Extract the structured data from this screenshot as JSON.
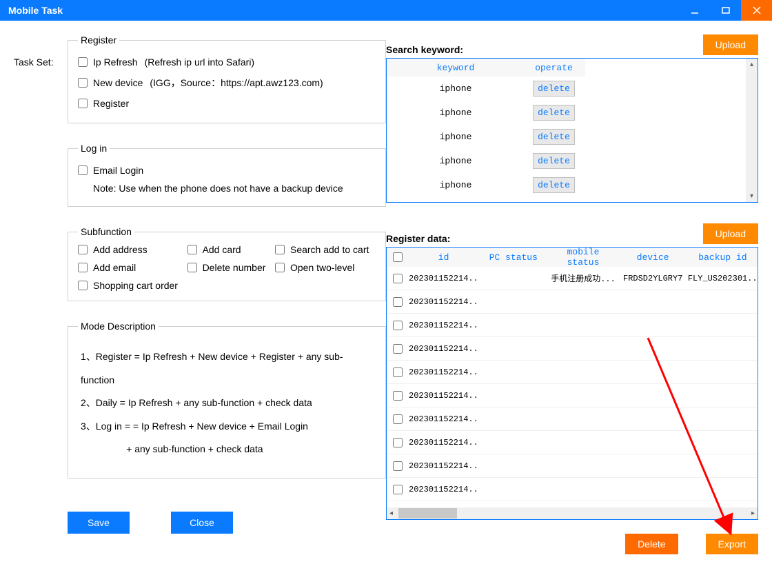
{
  "window": {
    "title": "Mobile Task"
  },
  "left": {
    "taskset_label": "Task Set:",
    "register": {
      "legend": "Register",
      "ip_refresh": "Ip Refresh",
      "ip_refresh_hint": "(Refresh ip url into Safari)",
      "new_device": "New device",
      "new_device_hint": "(IGG，Source：https://apt.awz123.com)",
      "register": "Register"
    },
    "login": {
      "legend": "Log in",
      "email_login": "Email Login",
      "note": "Note: Use when the phone does not have a backup device"
    },
    "subfunction": {
      "legend": "Subfunction",
      "add_address": "Add address",
      "add_card": "Add card",
      "search_add": "Search add to cart",
      "add_email": "Add email",
      "delete_number": "Delete number",
      "open_two": "Open two-level",
      "shopping_cart": "Shopping cart order"
    },
    "mode": {
      "legend": "Mode Description",
      "line1": "1、Register = Ip Refresh + New device + Register + any sub-function",
      "line2": "2、Daily =   Ip Refresh + any sub-function + check data",
      "line3": "3、Log in =  = Ip Refresh + New device + Email Login",
      "line4": "                 + any sub-function + check data"
    },
    "buttons": {
      "save": "Save",
      "close": "Close"
    }
  },
  "right": {
    "search_label": "Search keyword:",
    "upload": "Upload",
    "keyword_cols": {
      "keyword": "keyword",
      "operate": "operate"
    },
    "keywords": [
      {
        "k": "iphone",
        "op": "delete"
      },
      {
        "k": "iphone",
        "op": "delete"
      },
      {
        "k": "iphone",
        "op": "delete"
      },
      {
        "k": "iphone",
        "op": "delete"
      },
      {
        "k": "iphone",
        "op": "delete"
      }
    ],
    "register_label": "Register data:",
    "reg_cols": {
      "id": "id",
      "pc": "PC status",
      "mobile": "mobile status",
      "device": "device",
      "backup": "backup id"
    },
    "reg_rows": [
      {
        "id": "202301152214...",
        "pc": "",
        "mobile": "手机注册成功...",
        "device": "FRDSD2YLGRY7",
        "backup": "FLY_US202301..."
      },
      {
        "id": "202301152214...",
        "pc": "",
        "mobile": "",
        "device": "",
        "backup": ""
      },
      {
        "id": "202301152214...",
        "pc": "",
        "mobile": "",
        "device": "",
        "backup": ""
      },
      {
        "id": "202301152214...",
        "pc": "",
        "mobile": "",
        "device": "",
        "backup": ""
      },
      {
        "id": "202301152214...",
        "pc": "",
        "mobile": "",
        "device": "",
        "backup": ""
      },
      {
        "id": "202301152214...",
        "pc": "",
        "mobile": "",
        "device": "",
        "backup": ""
      },
      {
        "id": "202301152214...",
        "pc": "",
        "mobile": "",
        "device": "",
        "backup": ""
      },
      {
        "id": "202301152214...",
        "pc": "",
        "mobile": "",
        "device": "",
        "backup": ""
      },
      {
        "id": "202301152214...",
        "pc": "",
        "mobile": "",
        "device": "",
        "backup": ""
      },
      {
        "id": "202301152214...",
        "pc": "",
        "mobile": "",
        "device": "",
        "backup": ""
      }
    ],
    "delete": "Delete",
    "export": "Export"
  }
}
